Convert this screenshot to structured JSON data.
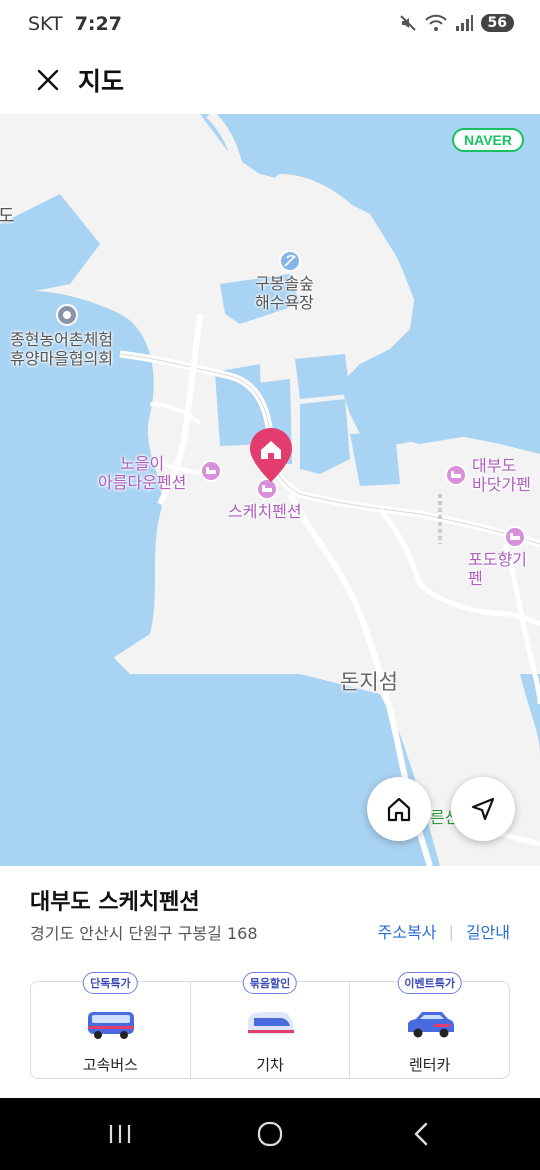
{
  "status_bar": {
    "carrier": "SKT",
    "time": "7:27",
    "battery": "56",
    "icons": [
      "mute-icon",
      "wifi-icon",
      "signal-icon"
    ]
  },
  "header": {
    "title": "지도",
    "close_icon": "close-icon"
  },
  "map": {
    "logo": "NAVER",
    "labels": {
      "edge_do": "도",
      "gubong_beach_1": "구봉솔숲",
      "gubong_beach_2": "해수욕장",
      "jonghyeon_1": "종현농어촌체험",
      "jonghyeon_2": "휴양마을협의회",
      "noeul_1": "노을이",
      "noeul_2": "아름다운펜션",
      "sketch_pension": "스케치펜션",
      "daebu_bada_1": "대부도",
      "daebu_bada_2": "바닷가펜",
      "podohyang": "포도향기펜",
      "donjiseom": "돈지섬",
      "partial_green": "른산"
    },
    "buttons": {
      "home": "home-icon",
      "location": "navigation-arrow-icon"
    }
  },
  "place": {
    "name": "대부도 스케치펜션",
    "address": "경기도 안산시 단원구 구봉길 168",
    "copy_address": "주소복사",
    "directions": "길안내"
  },
  "transport": [
    {
      "badge": "단독특가",
      "label": "고속버스",
      "icon": "bus-icon"
    },
    {
      "badge": "묶음할인",
      "label": "기차",
      "icon": "train-icon"
    },
    {
      "badge": "이벤트특가",
      "label": "렌터카",
      "icon": "car-icon"
    }
  ],
  "navbar": {
    "recent": "recent-apps-icon",
    "home": "home-circle-icon",
    "back": "back-icon"
  },
  "colors": {
    "sea": "#a9d3f2",
    "land": "#f3f3f3",
    "pin": "#e33c6e",
    "link": "#2d6ed6",
    "naver_green": "#17c25f"
  }
}
